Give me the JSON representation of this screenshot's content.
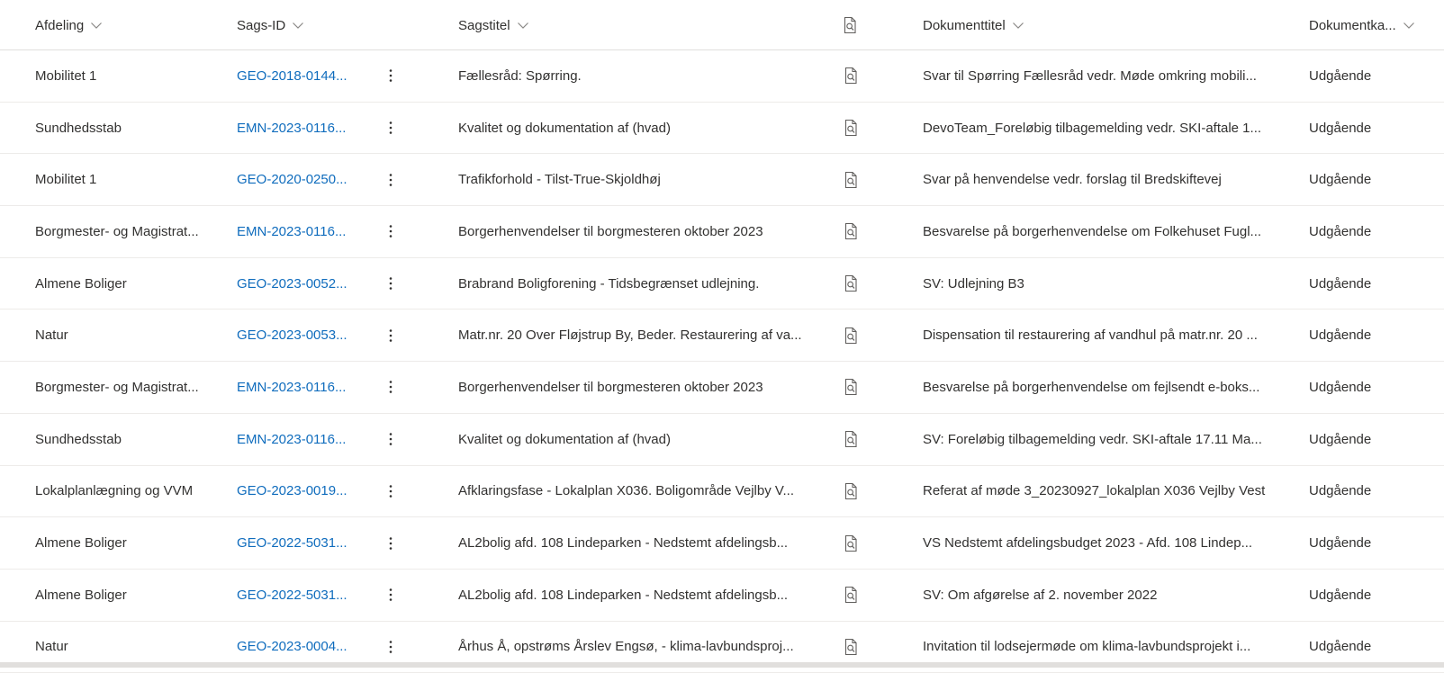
{
  "columns": {
    "afdeling": "Afdeling",
    "sags_id": "Sags-ID",
    "sagstitel": "Sagstitel",
    "preview_icon": "document-search-icon",
    "dokumenttitel": "Dokumenttitel",
    "dokumentkategori": "Dokumentka..."
  },
  "colors": {
    "link": "#0f6cbd",
    "text": "#323130",
    "border": "#edebe9"
  },
  "rows": [
    {
      "afdeling": "Mobilitet 1",
      "sags_id": "GEO-2018-0144...",
      "sagstitel": "Fællesråd: Spørring.",
      "dokumenttitel": "Svar til Spørring Fællesråd vedr. Møde omkring mobili...",
      "dokumentkategori": "Udgående"
    },
    {
      "afdeling": "Sundhedsstab",
      "sags_id": "EMN-2023-0116...",
      "sagstitel": "Kvalitet og dokumentation af (hvad)",
      "dokumenttitel": "DevoTeam_Foreløbig tilbagemelding vedr. SKI-aftale 1...",
      "dokumentkategori": "Udgående"
    },
    {
      "afdeling": "Mobilitet 1",
      "sags_id": "GEO-2020-0250...",
      "sagstitel": "Trafikforhold - Tilst-True-Skjoldhøj",
      "dokumenttitel": "Svar på henvendelse vedr. forslag til Bredskiftevej",
      "dokumentkategori": "Udgående"
    },
    {
      "afdeling": "Borgmester- og Magistrat...",
      "sags_id": "EMN-2023-0116...",
      "sagstitel": "Borgerhenvendelser til borgmesteren oktober 2023",
      "dokumenttitel": "Besvarelse på borgerhenvendelse om Folkehuset Fugl...",
      "dokumentkategori": "Udgående"
    },
    {
      "afdeling": "Almene Boliger",
      "sags_id": "GEO-2023-0052...",
      "sagstitel": "Brabrand Boligforening - Tidsbegrænset udlejning.",
      "dokumenttitel": "SV: Udlejning B3",
      "dokumentkategori": "Udgående"
    },
    {
      "afdeling": "Natur",
      "sags_id": "GEO-2023-0053...",
      "sagstitel": "Matr.nr. 20 Over Fløjstrup By, Beder. Restaurering af va...",
      "dokumenttitel": "Dispensation til restaurering af vandhul på matr.nr. 20 ...",
      "dokumentkategori": "Udgående"
    },
    {
      "afdeling": "Borgmester- og Magistrat...",
      "sags_id": "EMN-2023-0116...",
      "sagstitel": "Borgerhenvendelser til borgmesteren oktober 2023",
      "dokumenttitel": "Besvarelse på borgerhenvendelse om fejlsendt e-boks...",
      "dokumentkategori": "Udgående"
    },
    {
      "afdeling": "Sundhedsstab",
      "sags_id": "EMN-2023-0116...",
      "sagstitel": "Kvalitet og dokumentation af (hvad)",
      "dokumenttitel": "SV: Foreløbig tilbagemelding vedr. SKI-aftale 17.11 Ma...",
      "dokumentkategori": "Udgående"
    },
    {
      "afdeling": "Lokalplanlægning og VVM",
      "sags_id": "GEO-2023-0019...",
      "sagstitel": "Afklaringsfase - Lokalplan X036. Boligområde Vejlby V...",
      "dokumenttitel": "Referat af møde 3_20230927_lokalplan X036 Vejlby Vest",
      "dokumentkategori": "Udgående"
    },
    {
      "afdeling": "Almene Boliger",
      "sags_id": "GEO-2022-5031...",
      "sagstitel": "AL2bolig afd. 108 Lindeparken - Nedstemt afdelingsb...",
      "dokumenttitel": "VS Nedstemt afdelingsbudget 2023 - Afd. 108 Lindep...",
      "dokumentkategori": "Udgående"
    },
    {
      "afdeling": "Almene Boliger",
      "sags_id": "GEO-2022-5031...",
      "sagstitel": "AL2bolig afd. 108 Lindeparken - Nedstemt afdelingsb...",
      "dokumenttitel": "SV: Om afgørelse af 2. november 2022",
      "dokumentkategori": "Udgående"
    },
    {
      "afdeling": "Natur",
      "sags_id": "GEO-2023-0004...",
      "sagstitel": "Århus Å, opstrøms Årslev Engsø, - klima-lavbundsproj...",
      "dokumenttitel": "Invitation til lodsejermøde om klima-lavbundsprojekt i...",
      "dokumentkategori": "Udgående"
    }
  ]
}
